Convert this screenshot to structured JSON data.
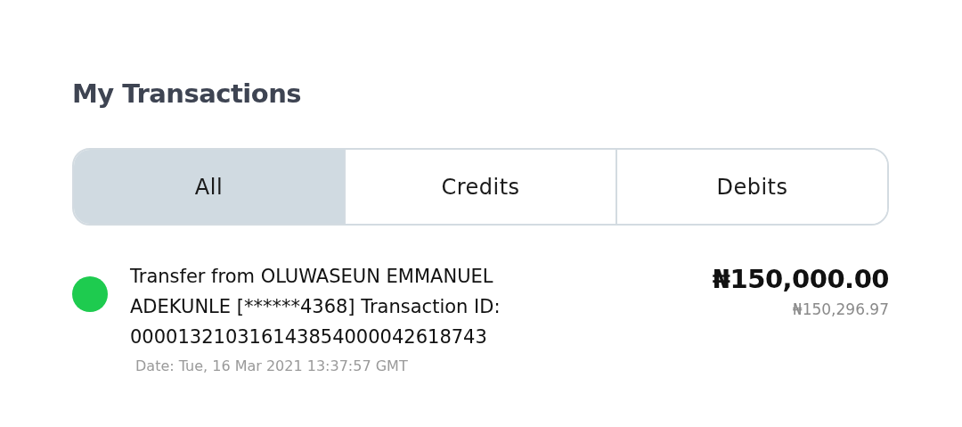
{
  "title": "My Transactions",
  "tabs": [
    {
      "label": "All",
      "selected": true
    },
    {
      "label": "Credits",
      "selected": false
    },
    {
      "label": "Debits",
      "selected": false
    }
  ],
  "transactions": [
    {
      "color": "#1ecb4f",
      "description": "Transfer from OLUWASEUN EMMANUEL ADEKUNLE [******4368] Transaction ID: 000013210316143854000042618743",
      "date": "Date: Tue, 16 Mar 2021 13:37:57 GMT",
      "amount": "₦150,000.00",
      "balance": "₦150,296.97"
    }
  ]
}
